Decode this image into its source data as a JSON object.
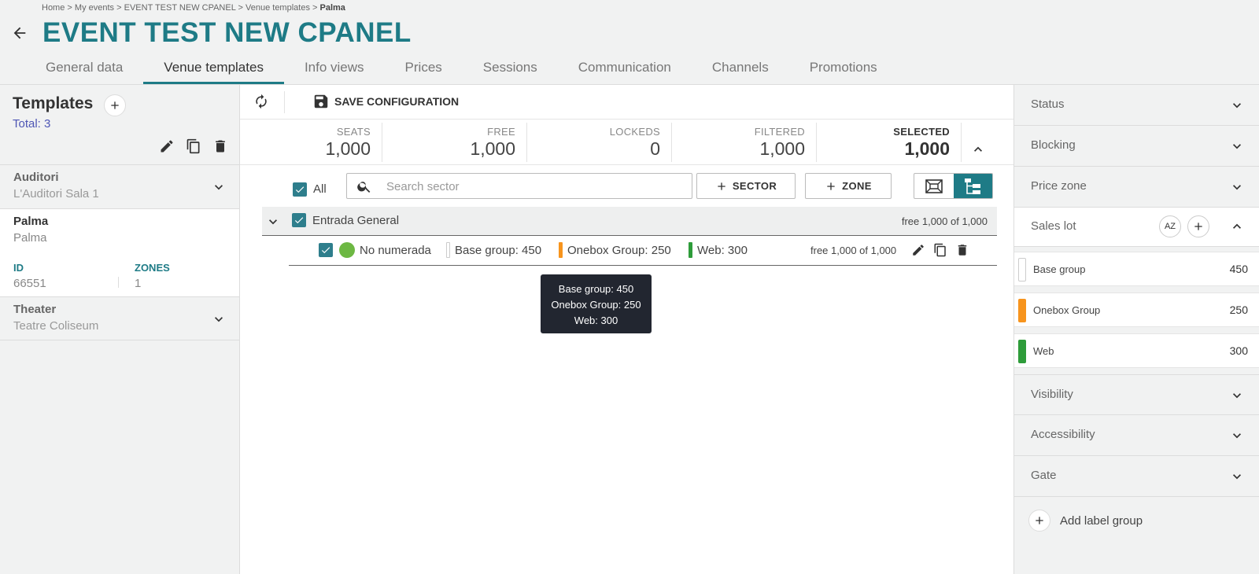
{
  "breadcrumb": {
    "home": "Home",
    "events": "My events",
    "event": "EVENT TEST NEW CPANEL",
    "templates": "Venue templates",
    "current": "Palma",
    "sep": ">"
  },
  "page": {
    "title": "EVENT TEST NEW CPANEL"
  },
  "tabs": [
    {
      "label": "General data"
    },
    {
      "label": "Venue templates",
      "active": true
    },
    {
      "label": "Info views"
    },
    {
      "label": "Prices"
    },
    {
      "label": "Sessions"
    },
    {
      "label": "Communication"
    },
    {
      "label": "Channels"
    },
    {
      "label": "Promotions"
    }
  ],
  "templates": {
    "title": "Templates",
    "total": "Total: 3",
    "items": [
      {
        "name": "Auditori",
        "sub": "L'Auditori Sala 1"
      },
      {
        "name": "Palma",
        "sub": "Palma",
        "id_label": "ID",
        "id_value": "66551",
        "zones_label": "ZONES",
        "zones_value": "1"
      },
      {
        "name": "Theater",
        "sub": "Teatre Coliseum"
      }
    ]
  },
  "toolbar": {
    "save_label": "SAVE CONFIGURATION"
  },
  "stats": {
    "seats": {
      "label": "SEATS",
      "value": "1,000"
    },
    "free": {
      "label": "FREE",
      "value": "1,000"
    },
    "lockeds": {
      "label": "LOCKEDS",
      "value": "0"
    },
    "filtered": {
      "label": "FILTERED",
      "value": "1,000"
    },
    "selected": {
      "label": "SELECTED",
      "value": "1,000"
    }
  },
  "filter": {
    "all_label": "All",
    "search_placeholder": "Search sector",
    "sector_button": "SECTOR",
    "zone_button": "ZONE"
  },
  "sector": {
    "name": "Entrada General",
    "free": "free 1,000 of 1,000"
  },
  "zone": {
    "name": "No numerada",
    "lots": [
      "Base group: 450",
      "Onebox Group: 250",
      "Web: 300"
    ],
    "free": "free 1,000 of 1,000"
  },
  "tooltip": {
    "lines": [
      "Base group: 450",
      "Onebox Group: 250",
      "Web: 300"
    ]
  },
  "right_panel": {
    "status": "Status",
    "blocking": "Blocking",
    "price_zone": "Price zone",
    "sales_lot": "Sales lot",
    "sort_label": "AZ",
    "lots": [
      {
        "name": "Base group",
        "count": "450",
        "color": "#ffffff"
      },
      {
        "name": "Onebox Group",
        "count": "250",
        "color": "#f7941d"
      },
      {
        "name": "Web",
        "count": "300",
        "color": "#2e9c3a"
      }
    ],
    "visibility": "Visibility",
    "accessibility": "Accessibility",
    "gate": "Gate",
    "add_label_group": "Add label group"
  },
  "colors": {
    "accent": "#1e7b86",
    "zone_dot": "#6db843"
  }
}
